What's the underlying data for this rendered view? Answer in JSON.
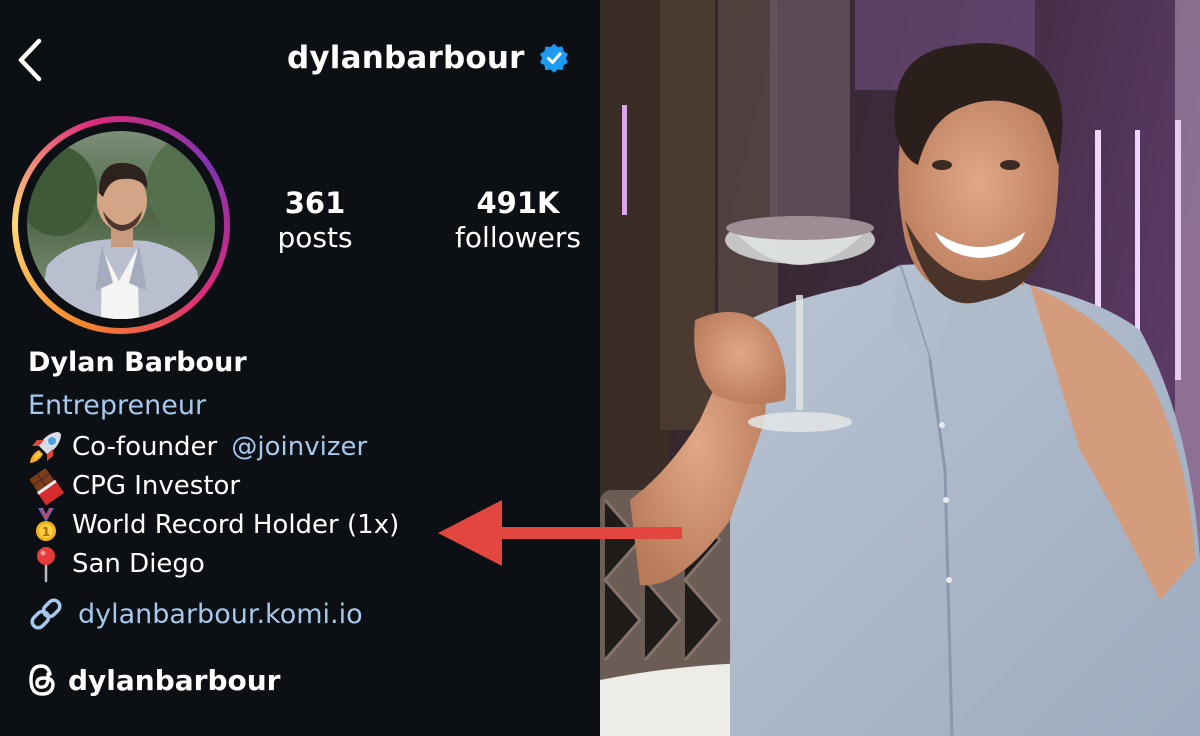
{
  "header": {
    "username": "dylanbarbour",
    "verified": true
  },
  "stats": [
    {
      "count": "361",
      "label": "posts"
    },
    {
      "count": "491K",
      "label": "followers"
    }
  ],
  "profile": {
    "display_name": "Dylan Barbour",
    "category": "Entrepreneur",
    "bio": {
      "line1_text": "Co-founder ",
      "line1_mention": "@joinvizer",
      "line2": "CPG Investor",
      "line3": "World Record Holder (1x)",
      "line4": "San Diego"
    },
    "link": "dylanbarbour.komi.io",
    "threads_handle": "dylanbarbour"
  },
  "colors": {
    "background": "#0c0f14",
    "link": "#a6c8ec",
    "verified": "#1d9bf0",
    "arrow": "#e2463f"
  },
  "icons": [
    "back-icon",
    "verified-badge-icon",
    "rocket-icon",
    "chocolate-icon",
    "medal-icon",
    "pin-icon",
    "link-icon",
    "threads-icon"
  ]
}
